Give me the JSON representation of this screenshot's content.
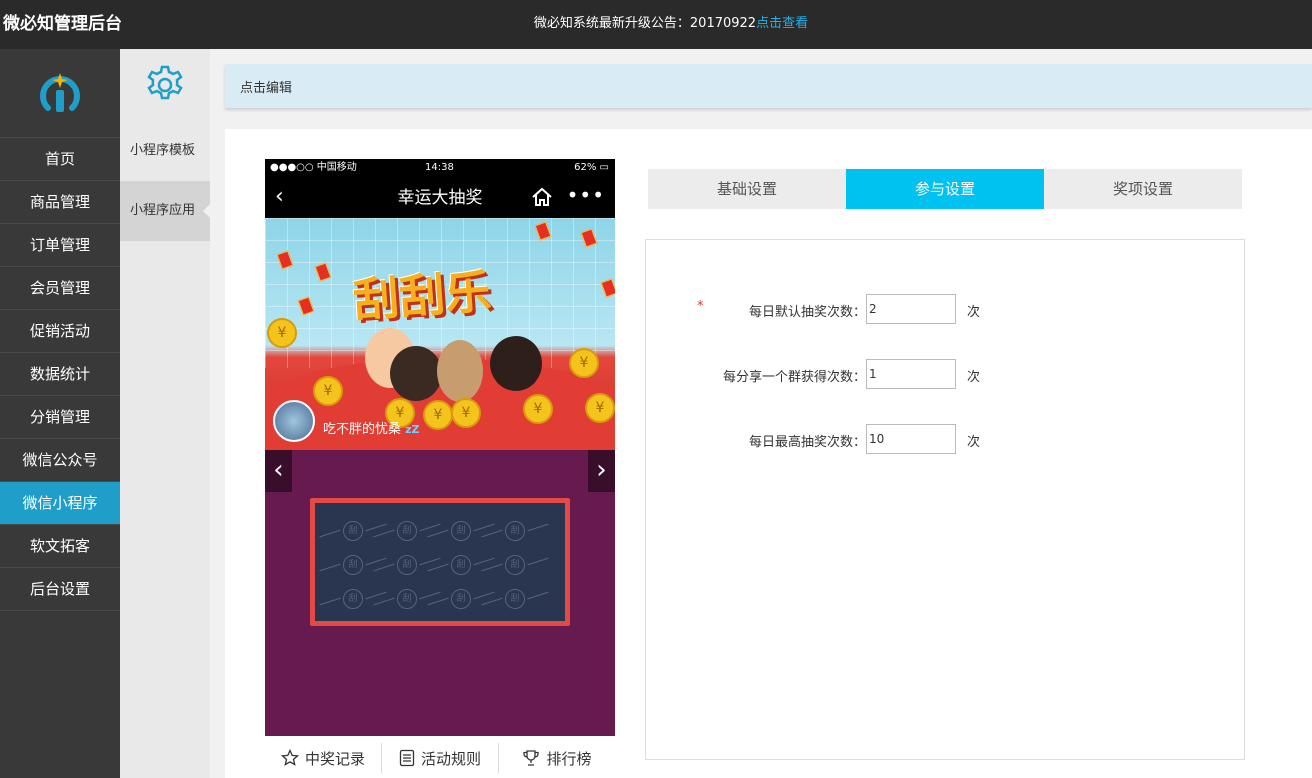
{
  "header": {
    "brand": "微必知管理后台",
    "notice_text": "微必知系统最新升级公告：20170922",
    "notice_link": "点击查看"
  },
  "nav": {
    "items": [
      {
        "label": "首页",
        "name": "nav-item-home"
      },
      {
        "label": "商品管理",
        "name": "nav-item-products"
      },
      {
        "label": "订单管理",
        "name": "nav-item-orders"
      },
      {
        "label": "会员管理",
        "name": "nav-item-members"
      },
      {
        "label": "促销活动",
        "name": "nav-item-promotions"
      },
      {
        "label": "数据统计",
        "name": "nav-item-statistics"
      },
      {
        "label": "分销管理",
        "name": "nav-item-distribution"
      },
      {
        "label": "微信公众号",
        "name": "nav-item-wechat-official"
      },
      {
        "label": "微信小程序",
        "name": "nav-item-mini-program"
      },
      {
        "label": "软文拓客",
        "name": "nav-item-content-marketing"
      },
      {
        "label": "后台设置",
        "name": "nav-item-settings"
      }
    ],
    "active_index": 8
  },
  "subnav": {
    "items": [
      {
        "label": "小程序模板"
      },
      {
        "label": "小程序应用"
      }
    ],
    "active_index": 1
  },
  "editbar": {
    "label": "点击编辑"
  },
  "phone": {
    "carrier": "●●●○○ 中国移动",
    "time": "14:38",
    "battery": "62%",
    "title": "幸运大抽奖",
    "banner_headline": "刮刮乐",
    "nickname": "吃不胖的忧桑",
    "scratch_glyph": "刮",
    "bottom_tabs": [
      {
        "label": "中奖记录",
        "icon": "star-icon"
      },
      {
        "label": "活动规则",
        "icon": "document-icon"
      },
      {
        "label": "排行榜",
        "icon": "trophy-icon"
      }
    ]
  },
  "settings": {
    "tabs": [
      {
        "label": "基础设置"
      },
      {
        "label": "参与设置"
      },
      {
        "label": "奖项设置"
      }
    ],
    "active_tab": 1,
    "fields": [
      {
        "label": "每日默认抽奖次数：",
        "value": "2",
        "unit": "次",
        "required": true
      },
      {
        "label": "每分享一个群获得次数：",
        "value": "1",
        "unit": "次",
        "required": false
      },
      {
        "label": "每日最高抽奖次数：",
        "value": "10",
        "unit": "次",
        "required": false
      }
    ],
    "required_mark": "*"
  },
  "colors": {
    "active_nav": "#1e9ec9",
    "active_tab": "#00c2f1",
    "link": "#1fb2e8",
    "required": "#e3343a"
  }
}
